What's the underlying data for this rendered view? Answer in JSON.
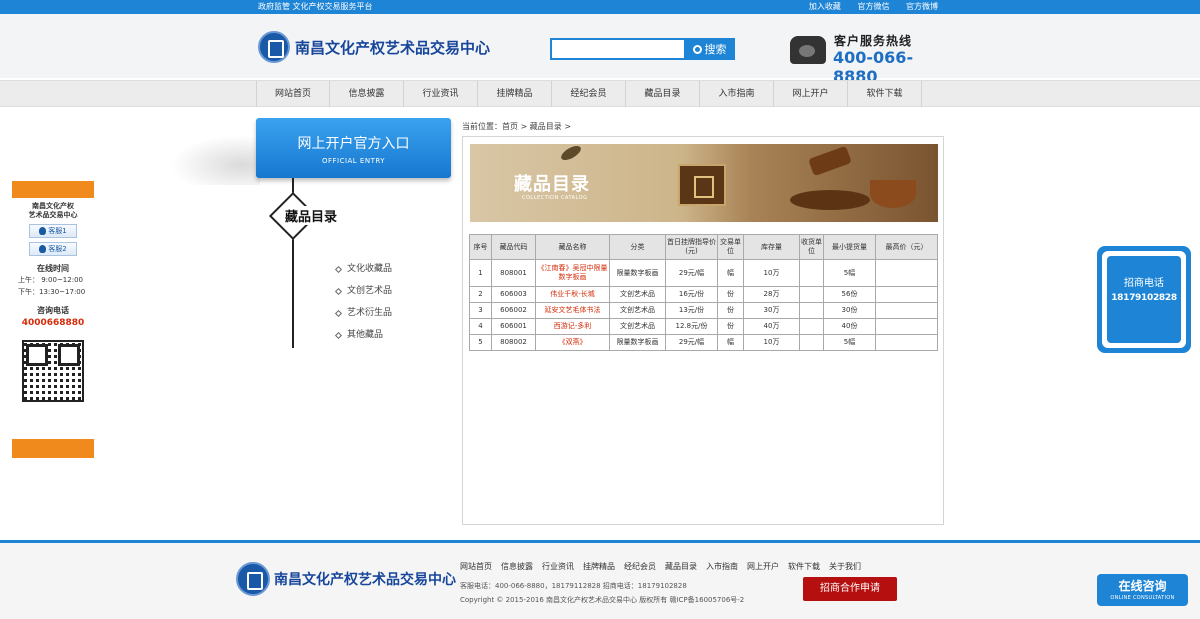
{
  "topbar": {
    "slogan": "政府监管  文化产权交易服务平台",
    "links": [
      "加入收藏",
      "官方微信",
      "官方微博"
    ]
  },
  "header": {
    "logo_text": "南昌文化产权艺术品交易中心",
    "search": {
      "placeholder": "",
      "button_label": "搜索"
    },
    "hotline": {
      "title": "客户服务热线",
      "number": "400-066-8880"
    }
  },
  "nav": {
    "items": [
      "网站首页",
      "信息披露",
      "行业资讯",
      "挂牌精品",
      "经纪会员",
      "藏品目录",
      "入市指南",
      "网上开户",
      "软件下载"
    ]
  },
  "left_float": {
    "title_line1": "南昌文化产权",
    "title_line2": "艺术品交易中心",
    "qq": [
      "客服1",
      "客服2"
    ],
    "online_time_title": "在线时间",
    "am": "上午：  9:00~12:00",
    "pm": "下午：13:30~17:00",
    "consult_title": "咨询电话",
    "consult_phone": "4000668880"
  },
  "right_float": {
    "title": "招商电话",
    "number": "18179102828"
  },
  "side": {
    "entry_cn": "网上开户官方入口",
    "entry_en": "OFFICIAL ENTRY",
    "section_title": "藏品目录",
    "submenu": [
      "文化收藏品",
      "文创艺术品",
      "艺术衍生品",
      "其他藏品"
    ]
  },
  "breadcrumb": {
    "prefix": "当前位置：",
    "home": "首页",
    "sep1": " > ",
    "current": "藏品目录",
    "sep2": " >"
  },
  "banner": {
    "cn": "藏品目录",
    "en": "COLLECTION CATALOG"
  },
  "table": {
    "headers": [
      "序号",
      "藏品代码",
      "藏品名称",
      "分类",
      "首日挂牌指导价(元)",
      "交易单位",
      "库存量",
      "收货单位",
      "最小提货量",
      "最高价（元）"
    ],
    "rows": [
      [
        "1",
        "808001",
        "《江南春》吴冠中限量数字板画",
        "限量数字板画",
        "29元/幅",
        "幅",
        "10万",
        "",
        "5幅",
        ""
      ],
      [
        "2",
        "606003",
        "伟业千秋-长城",
        "文创艺术品",
        "16元/份",
        "份",
        "28万",
        "",
        "56份",
        ""
      ],
      [
        "3",
        "606002",
        "延安文艺毛体书法",
        "文创艺术品",
        "13元/份",
        "份",
        "30万",
        "",
        "30份",
        ""
      ],
      [
        "4",
        "606001",
        "西游记-多利",
        "文创艺术品",
        "12.8元/份",
        "份",
        "40万",
        "",
        "40份",
        ""
      ],
      [
        "5",
        "808002",
        "《双燕》",
        "限量数字板画",
        "29元/幅",
        "幅",
        "10万",
        "",
        "5幅",
        ""
      ]
    ]
  },
  "footer": {
    "logo_text": "南昌文化产权艺术品交易中心",
    "links": [
      "网站首页",
      "信息披露",
      "行业资讯",
      "挂牌精品",
      "经纪会员",
      "藏品目录",
      "入市指南",
      "网上开户",
      "软件下载",
      "关于我们"
    ],
    "service": "客服电话：400-066-8880，18179112828  招商电话：18179102828",
    "copyright": "Copyright © 2015-2016 南昌文化产权艺术品交易中心 版权所有 赣ICP备16005706号-2",
    "apply_label": "招商合作申请",
    "online_cn": "在线咨询",
    "online_en": "ONLINE CONSULTATION"
  },
  "colors": {
    "brand_blue": "#1e84d6",
    "accent_orange": "#f08a1d",
    "alert_red": "#d62c0a",
    "apply_red": "#b50f0f"
  }
}
